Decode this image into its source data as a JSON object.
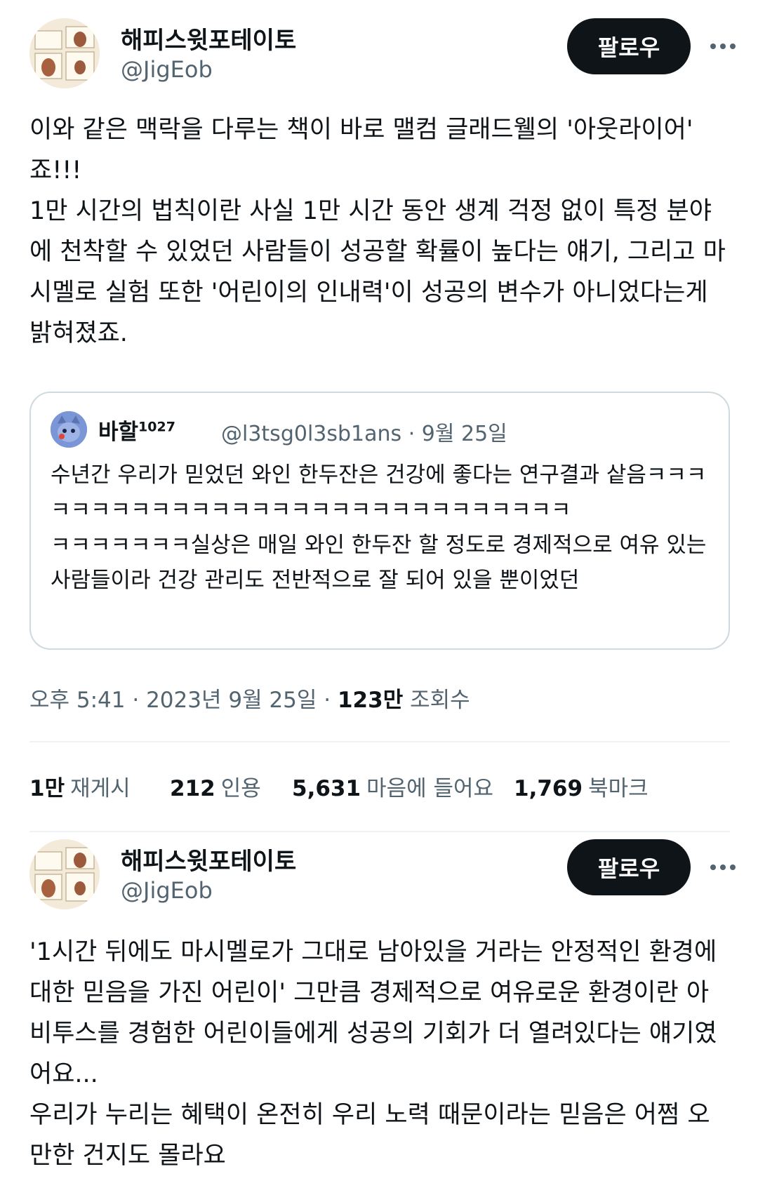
{
  "tweet1": {
    "author": {
      "name": "해피스윗포테이토",
      "handle": "@JigEob"
    },
    "follow_label": "팔로우",
    "text": "이와 같은 맥락을 다루는 책이 바로 맬컴 글래드웰의 '아웃라이어' 죠!!!\n1만 시간의 법칙이란 사실 1만 시간 동안 생계 걱정 없이 특정 분야에 천착할 수 있었던 사람들이 성공할 확률이 높다는 얘기, 그리고 마시멜로 실험 또한 '어린이의 인내력'이 성공의 변수가 아니었다는게 밝혀졌죠.",
    "quote": {
      "name": "바할",
      "name_sup": "1027",
      "handle": "@l3tsg0l3sb1ans",
      "date": "9월 25일",
      "text": "수년간 우리가 믿었던 와인 한두잔은 건강에 좋다는 연구결과 샅음ㅋㅋㅋㅋㅋㅋㅋㅋㅋㅋㅋㅋㅋㅋㅋㅋㅋㅋㅋㅋㅋㅋㅋㅋㅋㅋㅋㅋㅋ\nㅋㅋㅋㅋㅋㅋㅋ실상은 매일 와인 한두잔 할 정도로 경제적으로 여유 있는 사람들이라 건강 관리도 전반적으로 잘 되어 있을 뿐이었던"
    },
    "timestamp": {
      "time": "오후 5:41",
      "date": "2023년 9월 25일",
      "views": "123만",
      "views_label": "조회수"
    },
    "stats": [
      {
        "value": "1만",
        "label": "재게시"
      },
      {
        "value": "212",
        "label": "인용"
      },
      {
        "value": "5,631",
        "label": "마음에 들어요"
      },
      {
        "value": "1,769",
        "label": "북마크"
      }
    ]
  },
  "tweet2": {
    "author": {
      "name": "해피스윗포테이토",
      "handle": "@JigEob"
    },
    "follow_label": "팔로우",
    "text": "'1시간 뒤에도 마시멜로가 그대로 남아있을 거라는 안정적인 환경에 대한 믿음을 가진 어린이' 그만큼 경제적으로 여유로운 환경이란 아비투스를 경험한 어린이들에게 성공의 기회가 더 열려있다는 얘기였어요...\n우리가 누리는 혜택이 온전히 우리 노력 때문이라는 믿음은 어쩜 오만한 건지도 몰라요"
  },
  "icons": {
    "more": "more-horizontal-icon",
    "avatar": "profile-avatar",
    "quote_avatar": "cat-avatar"
  },
  "colors": {
    "text": "#0f1419",
    "secondary": "#536471",
    "border": "#cfd9de",
    "button": "#0f1419"
  }
}
